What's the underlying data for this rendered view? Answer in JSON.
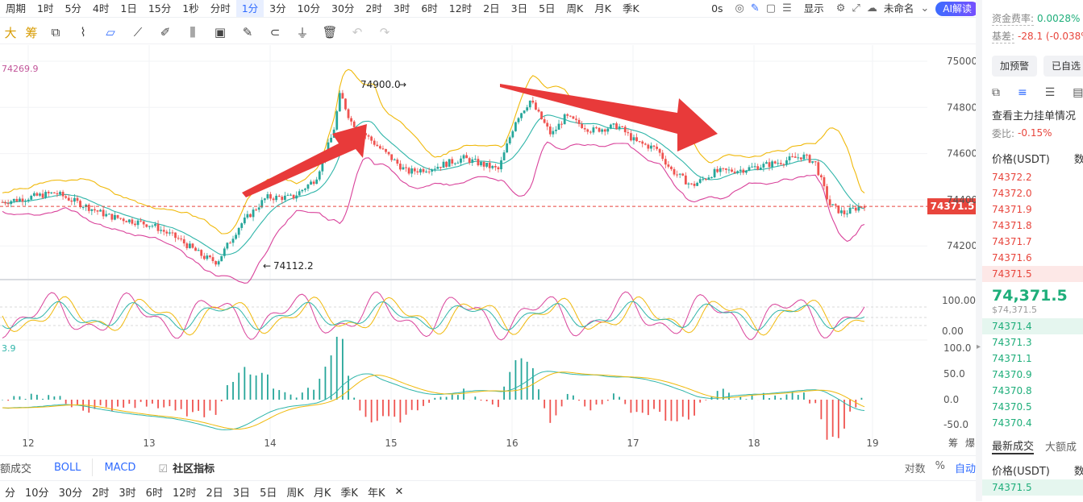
{
  "topbar": {
    "items": [
      "周期",
      "1时",
      "5分",
      "4时",
      "1日",
      "15分",
      "1秒",
      "分时",
      "1分",
      "3分",
      "10分",
      "30分",
      "2时",
      "3时",
      "6时",
      "12时",
      "2日",
      "3日",
      "5日",
      "周K",
      "月K",
      "季K"
    ],
    "active_index": 8,
    "timer": "0s",
    "display_label": "显示",
    "layout_name": "未命名",
    "ai_label": "AI解读"
  },
  "toolbar2": {
    "first_labels": [
      "大",
      "筹"
    ],
    "icons": [
      "copy-icon",
      "brush-icon",
      "ruler-icon",
      "rect-icon",
      "pen-icon",
      "candle-icon",
      "save-icon",
      "note-icon",
      "magnet-icon",
      "filter-icon",
      "trash-icon",
      "undo-icon",
      "redo-icon"
    ]
  },
  "chart": {
    "price_ticks": [
      "75000.0",
      "74800.0",
      "74600.0",
      "74400.0",
      "74200.0"
    ],
    "left_value": "74269.9",
    "high_label": "74900.0",
    "low_label": "74112.2",
    "current_price_tag": "74371.5",
    "kdj_ticks": [
      "100.00",
      "0.00"
    ],
    "kdj_left_value": "3.9",
    "macd_ticks": [
      "100.0",
      "50.0",
      "0.0",
      "-50.0"
    ],
    "x_labels": [
      "12",
      "13",
      "14",
      "15",
      "16",
      "17",
      "18",
      "19"
    ],
    "corner_labels": [
      "筹",
      "爆"
    ],
    "colors": {
      "up": "#26a69a",
      "down": "#ef5350",
      "boll_upper": "#f0b90b",
      "boll_mid": "#2fb5a9",
      "boll_lower": "#d9439b",
      "arrow": "#e83a3a",
      "price_tag": "#e8453c"
    }
  },
  "bottom1": {
    "tabs": [
      "额成交",
      "BOLL",
      "MACD",
      "社区指标"
    ],
    "right": [
      "对数",
      "%",
      "自动"
    ]
  },
  "bottom2": {
    "items": [
      "分",
      "10分",
      "30分",
      "2时",
      "3时",
      "6时",
      "12时",
      "2日",
      "3日",
      "5日",
      "周K",
      "月K",
      "季K",
      "年K"
    ],
    "close": "✕"
  },
  "rpanel": {
    "funding_label": "资金费率:",
    "funding_value": "0.0028%",
    "basis_label": "基差:",
    "basis_value": "-28.1 (-0.038%",
    "alert_btn": "加预警",
    "self_btn": "已自选",
    "view_label": "查看主力挂单情况",
    "ratio_label": "委比:",
    "ratio_value": "-0.15%",
    "price_header": "价格(USDT)",
    "qty_header": "数",
    "asks": [
      "74372.2",
      "74372.0",
      "74371.9",
      "74371.8",
      "74371.7",
      "74371.6",
      "74371.5"
    ],
    "last_price": "74,371.5",
    "last_price_sub": "$74,371.5",
    "bids": [
      "74371.4",
      "74371.3",
      "74371.1",
      "74370.9",
      "74370.8",
      "74370.5",
      "74370.4"
    ],
    "trades_tab": "最新成交",
    "big_tab": "大额成",
    "trades_header": "价格(USDT)",
    "trades_qty": "数",
    "trades_first": "74371.5"
  }
}
